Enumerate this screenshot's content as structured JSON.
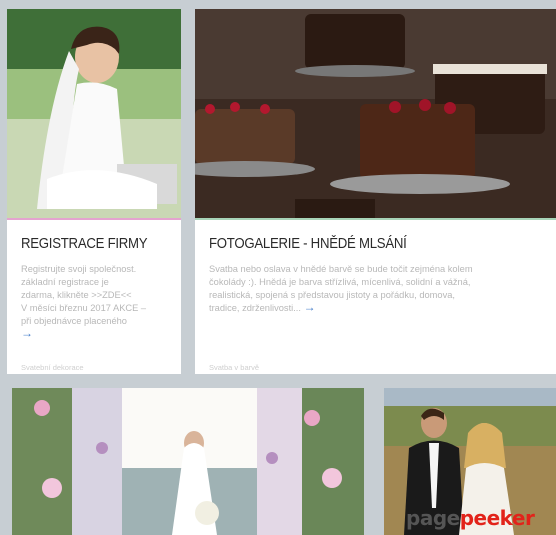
{
  "cards": [
    {
      "title": "REGISTRACE FIRMY",
      "lines": [
        "Registrujte svoji společnost.",
        "základní registrace je",
        "zdarma, klikněte  >>ZDE<<",
        "V měsíci březnu 2017 AKCE –",
        "při objednávce placeného"
      ],
      "arrow": "→",
      "tag": "Svatební dekorace",
      "accent": "#e4a4cf"
    },
    {
      "title": "FOTOGALERIE - HNĚDÉ MLSÁNÍ",
      "lines": [
        "Svatba nebo oslava v hnědé barvě se bude točit zejména kolem",
        "čokolády :). Hnědá je barva střízlivá, mícenlivá, solidní a vážná,",
        "realistická, spojená s představou jistoty a pořádku, domova,",
        "tradice, zdrženlivosti..."
      ],
      "arrow": "→",
      "tag": "Svatba v barvě",
      "accent": "#a8d4b8"
    }
  ],
  "watermark": {
    "part1": "page",
    "part2": "peeker"
  },
  "colors": {
    "background": "#c7ced3",
    "link": "#3f79c8",
    "watermark_red": "#e2231a"
  }
}
